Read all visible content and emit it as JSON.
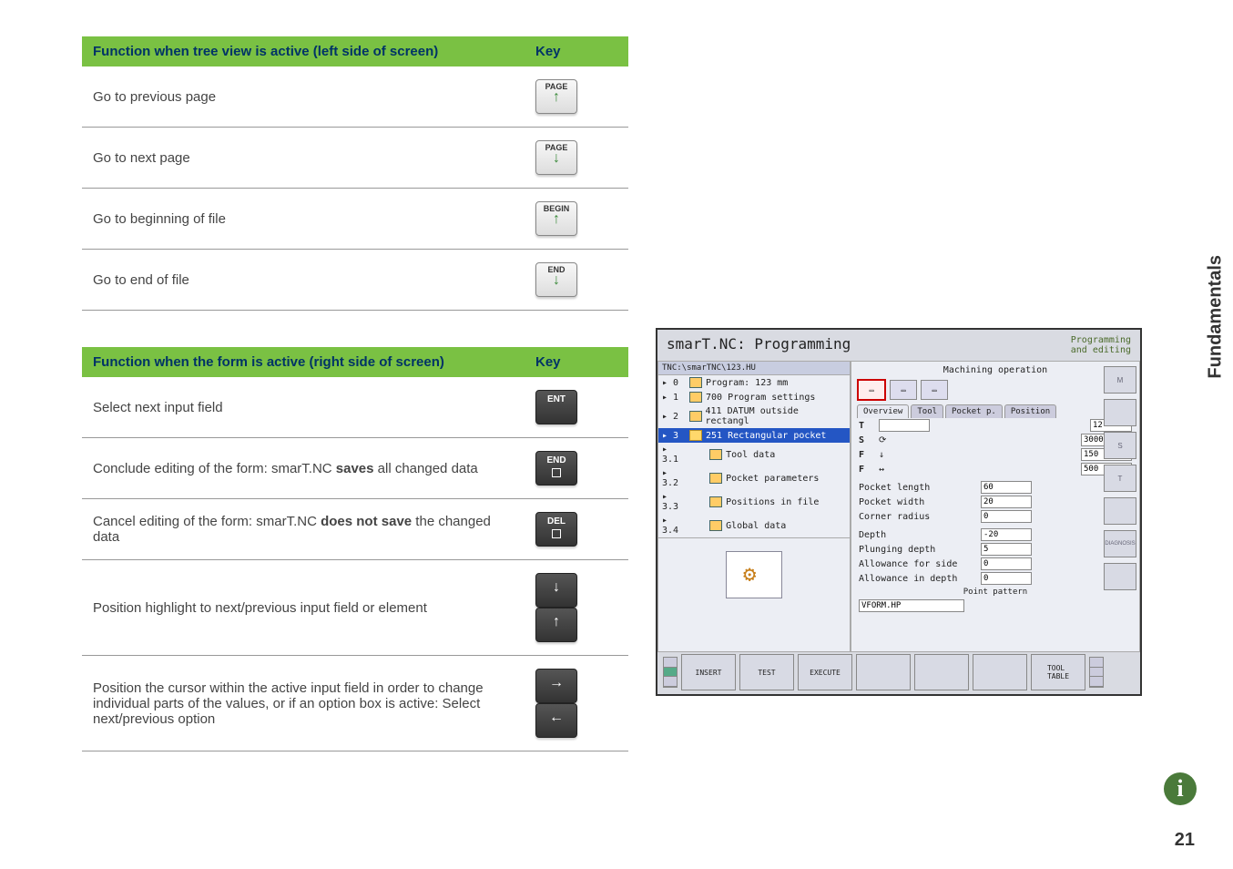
{
  "table1": {
    "header_func": "Function when tree view is active (left side of screen)",
    "header_key": "Key",
    "rows": [
      {
        "func": "Go to previous page",
        "key_label": "PAGE",
        "arrow": "↑",
        "style": "light"
      },
      {
        "func": "Go to next page",
        "key_label": "PAGE",
        "arrow": "↓",
        "style": "light"
      },
      {
        "func": "Go to beginning of file",
        "key_label": "BEGIN",
        "arrow": "↑",
        "style": "light"
      },
      {
        "func": "Go to end of file",
        "key_label": "END",
        "arrow": "↓",
        "style": "light"
      }
    ]
  },
  "table2": {
    "header_func": "Function when the form is active (right side of screen)",
    "header_key": "Key",
    "rows": [
      {
        "func": "Select next input field",
        "keys": [
          {
            "label": "ENT",
            "style": "dark"
          }
        ]
      },
      {
        "func": "Conclude editing of the form: smarT.NC saves all changed data",
        "bold_word": "saves",
        "keys": [
          {
            "label": "END",
            "style": "dark",
            "square": true
          }
        ]
      },
      {
        "func": "Cancel editing of the form: smarT.NC does not save the changed data",
        "bold_word": "does not save",
        "keys": [
          {
            "label": "DEL",
            "style": "dark",
            "square": true
          }
        ]
      },
      {
        "func": "Position highlight to next/previous input field or element",
        "keys": [
          {
            "arrow": "↓",
            "style": "dark"
          },
          {
            "arrow": "↑",
            "style": "dark"
          }
        ]
      },
      {
        "func": "Position the cursor within the active input field in order to change individual parts of the values, or if an option box is active: Select next/previous option",
        "keys": [
          {
            "arrow": "→",
            "style": "dark"
          },
          {
            "arrow": "←",
            "style": "dark"
          }
        ]
      }
    ]
  },
  "sidebar": "Fundamentals",
  "pagenum": "21",
  "shot": {
    "title": "smarT.NC: Programming",
    "mode1": "Programming",
    "mode2": "and editing",
    "tree_path": "TNC:\\smarTNC\\123.HU",
    "form_header": "Machining operation",
    "tree": [
      {
        "num": "0",
        "label": "Program: 123 mm"
      },
      {
        "num": "1",
        "label": "700 Program settings"
      },
      {
        "num": "2",
        "label": "411 DATUM outside rectangl"
      },
      {
        "num": "3",
        "label": "251 Rectangular pocket",
        "sel": true
      },
      {
        "num": "3.1",
        "label": "Tool data",
        "indent": true
      },
      {
        "num": "3.2",
        "label": "Pocket parameters",
        "indent": true
      },
      {
        "num": "3.3",
        "label": "Positions in file",
        "indent": true
      },
      {
        "num": "3.4",
        "label": "Global data",
        "indent": true
      }
    ],
    "tabs": [
      "Overview",
      "Tool",
      "Pocket p.",
      "Position"
    ],
    "fields_top": [
      {
        "label": "T",
        "value": ""
      },
      {
        "label": "S",
        "value": "3000",
        "icon": "⟳"
      },
      {
        "label": "F",
        "value": "150",
        "icon": "↓"
      },
      {
        "label": "F",
        "value": "500",
        "icon": "↔"
      }
    ],
    "field_12": "12",
    "fields_mid": [
      {
        "label": "Pocket length",
        "value": "60"
      },
      {
        "label": "Pocket width",
        "value": "20"
      },
      {
        "label": "Corner radius",
        "value": "0"
      }
    ],
    "fields_bot": [
      {
        "label": "Depth",
        "value": "-20"
      },
      {
        "label": "Plunging depth",
        "value": "5"
      },
      {
        "label": "Allowance for side",
        "value": "0"
      },
      {
        "label": "Allowance in depth",
        "value": "0"
      }
    ],
    "pattern_label": "Point pattern",
    "pattern_file": "VFORM.HP",
    "sideicons": [
      "M",
      "",
      "S",
      "T",
      "",
      "DIAGNOSIS",
      ""
    ],
    "softkeys": [
      "INSERT",
      "TEST",
      "EXECUTE",
      "",
      "",
      "",
      "TOOL\nTABLE"
    ]
  }
}
